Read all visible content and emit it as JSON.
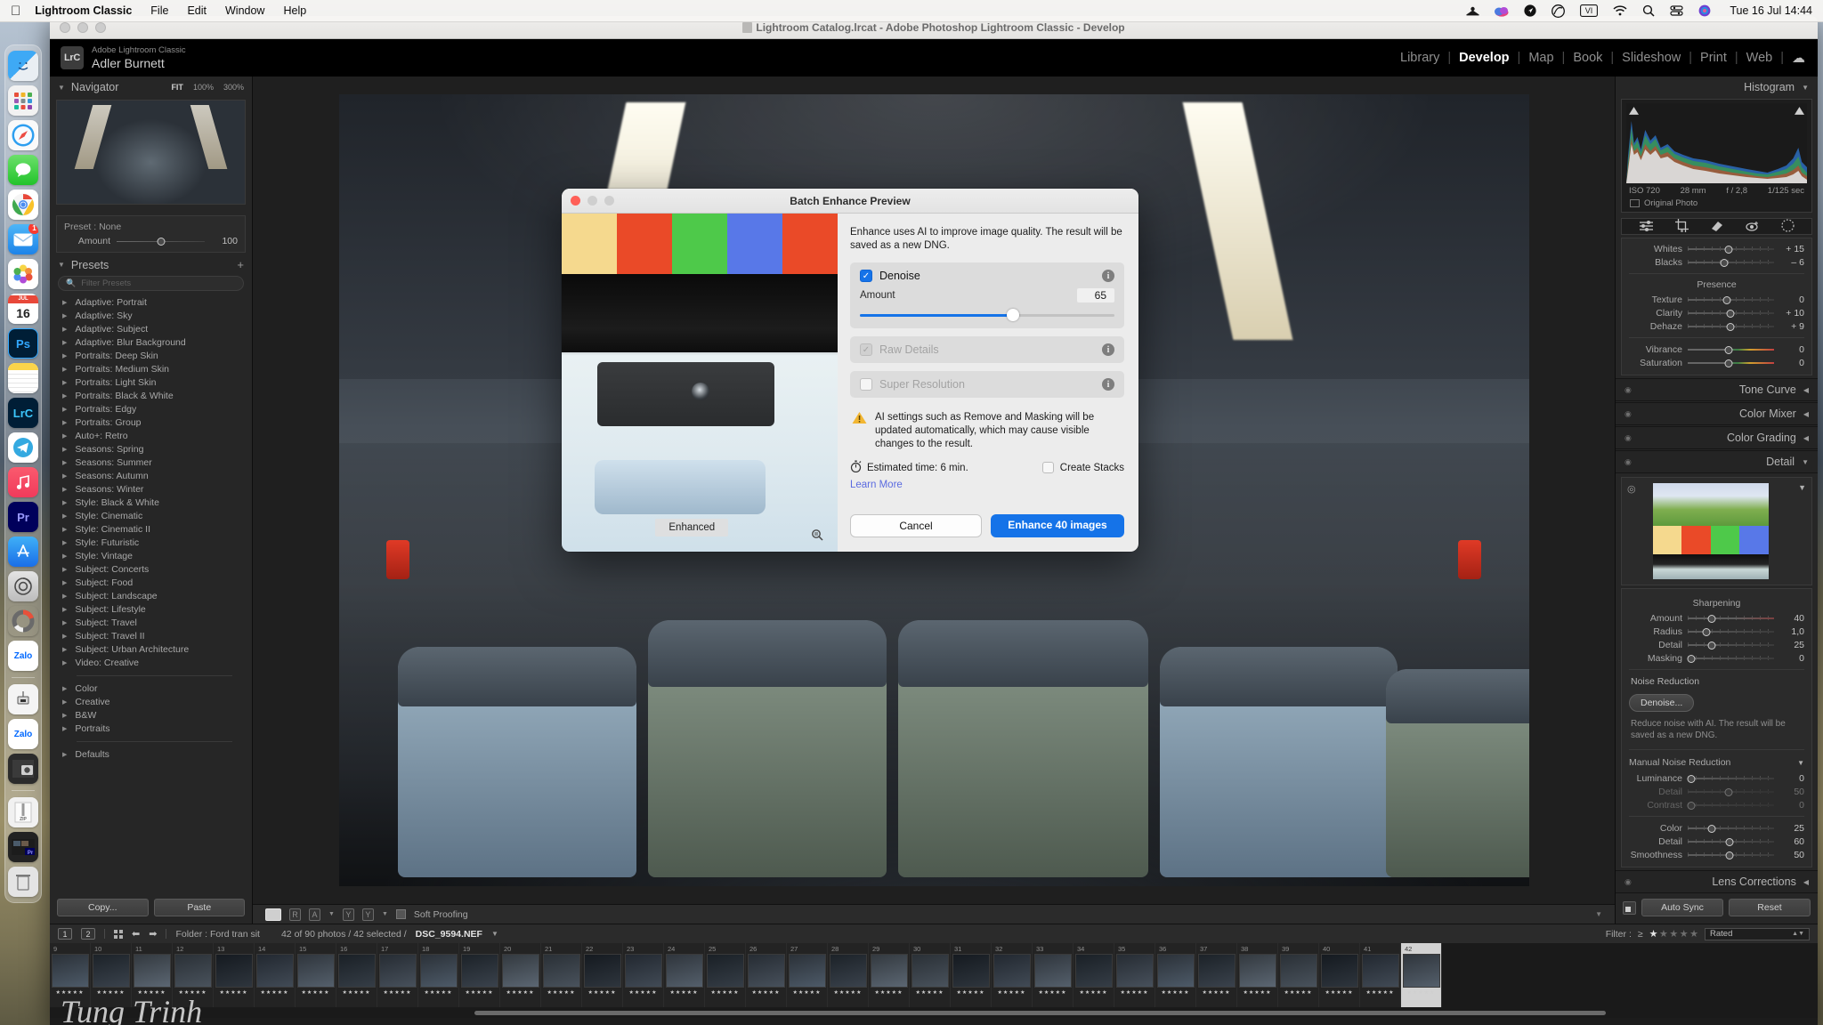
{
  "macos": {
    "apple_icon": "apple-logo-icon",
    "menus": [
      {
        "label": "Lightroom Classic",
        "bold": true
      },
      {
        "label": "File",
        "bold": false
      },
      {
        "label": "Edit",
        "bold": false
      },
      {
        "label": "Window",
        "bold": false
      },
      {
        "label": "Help",
        "bold": false
      }
    ],
    "status_icons": [
      "drone-icon",
      "adobe-cc-cloud-icon",
      "location-icon",
      "creative-cloud-icon",
      "vi-input-icon",
      "wifi-icon",
      "search-icon",
      "control-center-icon",
      "siri-icon"
    ],
    "clock": "Tue 16 Jul  14:44",
    "dock": [
      {
        "name": "finder",
        "label": "Finder"
      },
      {
        "name": "launchpad",
        "label": "Launchpad"
      },
      {
        "name": "safari",
        "label": "Safari"
      },
      {
        "name": "messages",
        "label": "Messages"
      },
      {
        "name": "chrome",
        "label": "Google Chrome"
      },
      {
        "name": "mail",
        "label": "Mail",
        "badge": "1"
      },
      {
        "name": "photos",
        "label": "Photos"
      },
      {
        "name": "calendar",
        "label": "JUL 16"
      },
      {
        "name": "photoshop",
        "label": "Ps"
      },
      {
        "name": "notes",
        "label": "Notes"
      },
      {
        "name": "lightroom-classic",
        "label": "LrC"
      },
      {
        "name": "telegram",
        "label": "Telegram"
      },
      {
        "name": "music",
        "label": "Music"
      },
      {
        "name": "premiere-pro",
        "label": "Pr"
      },
      {
        "name": "app-store",
        "label": "App Store"
      },
      {
        "name": "system-settings",
        "label": "System Settings"
      },
      {
        "name": "disk-usage",
        "label": "Disk Usage"
      },
      {
        "name": "zalo",
        "label": "Zalo"
      },
      {
        "name": "divider",
        "label": ""
      },
      {
        "name": "gpu-tool",
        "label": "GPU Tool"
      },
      {
        "name": "zalo-doc",
        "label": "Zalo"
      },
      {
        "name": "camera-folder",
        "label": "Camera"
      },
      {
        "name": "divider2",
        "label": ""
      },
      {
        "name": "zip-file",
        "label": "ZIP"
      },
      {
        "name": "premiere-project",
        "label": "Pr Project"
      },
      {
        "name": "trash",
        "label": "Trash"
      }
    ]
  },
  "window": {
    "title": "Lightroom Catalog.lrcat - Adobe Photoshop Lightroom Classic - Develop",
    "doc_icon": "document-icon"
  },
  "identity": {
    "badge": "LrC",
    "app_name": "Adobe Lightroom Classic",
    "user_name": "Adler Burnett"
  },
  "modules": {
    "items": [
      {
        "label": "Library",
        "active": false
      },
      {
        "label": "Develop",
        "active": true
      },
      {
        "label": "Map",
        "active": false
      },
      {
        "label": "Book",
        "active": false
      },
      {
        "label": "Slideshow",
        "active": false
      },
      {
        "label": "Print",
        "active": false
      },
      {
        "label": "Web",
        "active": false
      }
    ],
    "cloud_icon": "cloud-icon"
  },
  "left_panel": {
    "navigator": {
      "title": "Navigator",
      "fit": "FIT",
      "zoom_100": "100%",
      "zoom_300": "300%"
    },
    "preset_box": {
      "preset_label": "Preset : None",
      "amount_label": "Amount",
      "amount_value": "100"
    },
    "presets": {
      "title": "Presets",
      "add_icon": "plus-icon",
      "filter_placeholder": "Filter Presets",
      "search_icon": "search-icon",
      "groups": [
        [
          "Adaptive: Portrait",
          "Adaptive: Sky",
          "Adaptive: Subject",
          "Adaptive: Blur Background",
          "Portraits: Deep Skin",
          "Portraits: Medium Skin",
          "Portraits: Light Skin",
          "Portraits: Black & White",
          "Portraits: Edgy",
          "Portraits: Group",
          "Auto+: Retro",
          "Seasons: Spring",
          "Seasons: Summer",
          "Seasons: Autumn",
          "Seasons: Winter",
          "Style: Black & White",
          "Style: Cinematic",
          "Style: Cinematic II",
          "Style: Futuristic",
          "Style: Vintage",
          "Subject: Concerts",
          "Subject: Food",
          "Subject: Landscape",
          "Subject: Lifestyle",
          "Subject: Travel",
          "Subject: Travel II",
          "Subject: Urban Architecture",
          "Video: Creative"
        ],
        [
          "Color",
          "Creative",
          "B&W",
          "Portraits"
        ],
        [
          "Defaults"
        ]
      ]
    },
    "copy_label": "Copy...",
    "paste_label": "Paste"
  },
  "toolbar": {
    "soft_proofing": "Soft Proofing",
    "compare_ra": "RA",
    "compare_yy": "YY"
  },
  "right_panel": {
    "histogram": {
      "title": "Histogram",
      "iso": "ISO 720",
      "focal": "28 mm",
      "aperture": "f / 2,8",
      "shutter": "1/125 sec",
      "original_photo": "Original Photo"
    },
    "tools": [
      "adjust-icon",
      "crop-icon",
      "heal-icon",
      "redeye-icon",
      "mask-icon"
    ],
    "basic_sliders": [
      {
        "label": "Whites",
        "value": "+ 15",
        "pos": 47
      },
      {
        "label": "Blacks",
        "value": "– 6",
        "pos": 42
      }
    ],
    "presence_label": "Presence",
    "presence_sliders": [
      {
        "label": "Texture",
        "value": "0",
        "pos": 45
      },
      {
        "label": "Clarity",
        "value": "+ 10",
        "pos": 49
      },
      {
        "label": "Dehaze",
        "value": "+ 9",
        "pos": 49
      }
    ],
    "color_sliders": [
      {
        "label": "Vibrance",
        "value": "0",
        "pos": 47
      },
      {
        "label": "Saturation",
        "value": "0",
        "pos": 47
      }
    ],
    "collapsed_panels": [
      {
        "label": "Tone Curve"
      },
      {
        "label": "Color Mixer"
      },
      {
        "label": "Color Grading"
      }
    ],
    "detail": {
      "title": "Detail",
      "sharpening_label": "Sharpening",
      "sharpening": [
        {
          "label": "Amount",
          "value": "40",
          "pos": 28
        },
        {
          "label": "Radius",
          "value": "1,0",
          "pos": 22
        },
        {
          "label": "Detail",
          "value": "25",
          "pos": 28
        },
        {
          "label": "Masking",
          "value": "0",
          "pos": 3
        }
      ],
      "noise_reduction_label": "Noise Reduction",
      "denoise_button": "Denoise...",
      "denoise_desc": "Reduce noise with AI. The result will be saved as a new DNG.",
      "manual_label": "Manual Noise Reduction",
      "manual": [
        {
          "label": "Luminance",
          "value": "0",
          "pos": 3,
          "dim": false
        },
        {
          "label": "Detail",
          "value": "50",
          "pos": 47,
          "dim": true
        },
        {
          "label": "Contrast",
          "value": "0",
          "pos": 3,
          "dim": true
        },
        {
          "label": "Color",
          "value": "25",
          "pos": 28,
          "dim": false
        },
        {
          "label": "Detail",
          "value": "60",
          "pos": 48,
          "dim": false
        },
        {
          "label": "Smoothness",
          "value": "50",
          "pos": 48,
          "dim": false
        }
      ]
    },
    "lens_corrections": "Lens Corrections",
    "auto_sync": "Auto Sync",
    "reset": "Reset"
  },
  "filmstrip_bar": {
    "view_1": "1",
    "view_2": "2",
    "grid_icon": "grid-icon",
    "back_arrow": "arrow-left-icon",
    "forward_arrow": "arrow-right-icon",
    "folder": "Folder : Ford tran sit",
    "photo_count": "42 of 90 photos / 42 selected /",
    "filename": "DSC_9594.NEF",
    "filter_label": "Filter :",
    "filter_op": "≥",
    "stars_on": 1,
    "rated_value": "Rated"
  },
  "filmstrip": {
    "thumbs": [
      {
        "n": "9"
      },
      {
        "n": "10"
      },
      {
        "n": "11"
      },
      {
        "n": "12"
      },
      {
        "n": "13"
      },
      {
        "n": "14"
      },
      {
        "n": "15"
      },
      {
        "n": "16"
      },
      {
        "n": "17"
      },
      {
        "n": "18"
      },
      {
        "n": "19"
      },
      {
        "n": "20"
      },
      {
        "n": "21"
      },
      {
        "n": "22"
      },
      {
        "n": "23"
      },
      {
        "n": "24"
      },
      {
        "n": "25"
      },
      {
        "n": "26"
      },
      {
        "n": "27"
      },
      {
        "n": "28"
      },
      {
        "n": "29"
      },
      {
        "n": "30"
      },
      {
        "n": "31"
      },
      {
        "n": "32"
      },
      {
        "n": "33"
      },
      {
        "n": "34"
      },
      {
        "n": "35"
      },
      {
        "n": "36"
      },
      {
        "n": "37"
      },
      {
        "n": "38"
      },
      {
        "n": "39"
      },
      {
        "n": "40"
      },
      {
        "n": "41"
      },
      {
        "n": "42"
      }
    ],
    "rating": "★★★★★",
    "watermark": "Tung Trinh"
  },
  "modal": {
    "title": "Batch Enhance Preview",
    "preview_badge": "Enhanced",
    "zoom_icon": "magnifier-icon",
    "description": "Enhance uses AI to improve image quality. The result will be saved as a new DNG.",
    "denoise": {
      "label": "Denoise",
      "checked": true,
      "amount_label": "Amount",
      "amount_value": "65",
      "slider_pct": 60,
      "info_icon": "info-icon"
    },
    "raw_details": {
      "label": "Raw Details",
      "checked": true,
      "disabled": true,
      "info_icon": "info-icon"
    },
    "super_resolution": {
      "label": "Super Resolution",
      "checked": false,
      "disabled": true,
      "info_icon": "info-icon"
    },
    "warning": {
      "icon": "warning-triangle-icon",
      "text": "AI settings such as Remove and Masking will be updated automatically, which may cause visible changes to the result."
    },
    "estimated": {
      "icon": "stopwatch-icon",
      "text": "Estimated time: 6 min."
    },
    "create_stacks": {
      "label": "Create Stacks",
      "checked": false
    },
    "learn_more": "Learn More",
    "cancel": "Cancel",
    "confirm": "Enhance 40 images"
  },
  "colors": {
    "accent_blue": "#1573e8",
    "panel_bg": "#262626",
    "modal_bg": "#ececec",
    "link": "#5b6be0"
  }
}
